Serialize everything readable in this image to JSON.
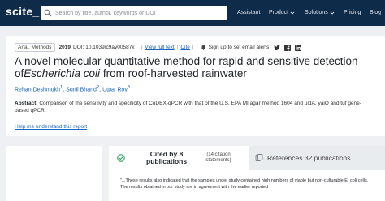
{
  "nav": {
    "logo": "scite_",
    "search_placeholder": "Search by title, author, keywords or DOI",
    "items": [
      {
        "label": "Assistant",
        "dropdown": false
      },
      {
        "label": "Product",
        "dropdown": true
      },
      {
        "label": "Solutions",
        "dropdown": true
      },
      {
        "label": "Pricing",
        "dropdown": false
      },
      {
        "label": "Blog",
        "dropdown": false
      }
    ]
  },
  "paper": {
    "journal_badge": "Anal. Methods",
    "year": "2019",
    "doi": "DOI: 10.1039/c9ay00587k",
    "view_full_text": "View full text",
    "cite": "Cite",
    "alerts": "Sign up to set email alerts",
    "title_part1": "A novel molecular quantitative method for rapid and sensitive detection of",
    "title_italic": "Escherichia coli",
    "title_part2": "from roof-harvested rainwater",
    "authors": [
      {
        "name": "Rehan Deshmukh",
        "mark": "1"
      },
      {
        "name": "Sunil Bhand",
        "mark": "2"
      },
      {
        "name": "Utpal Roy",
        "mark": "3"
      }
    ],
    "abstract_label": "Abstract:",
    "abstract_text": "Comparison of the sensitivity and specificity of CoDEX-qPCR with that of the U.S. EPA MI agar method 1604 and uidA, yaiO and tuf gene-based qPCR.",
    "help_link": "Help me understand this report"
  },
  "citations": {
    "cited_by": "Cited by 8 publications",
    "citation_note": "(14 citation statements)",
    "references": "References 32 publications",
    "snippet": "\"...These results also indicated that the samples under study contained high numbers of viable but non-culturable E. coli cells. The results obtained in our study are in agreement with the earlier reported"
  },
  "colors": {
    "nav_bg": "#0f2b4a",
    "link": "#1a66c2",
    "cited_icon": "#2e9e5b"
  },
  "icons": [
    "search-icon",
    "chevron-down-icon",
    "bell-icon",
    "twitter-icon",
    "facebook-icon",
    "linkedin-icon",
    "citation-bubble-icon",
    "references-icon"
  ]
}
